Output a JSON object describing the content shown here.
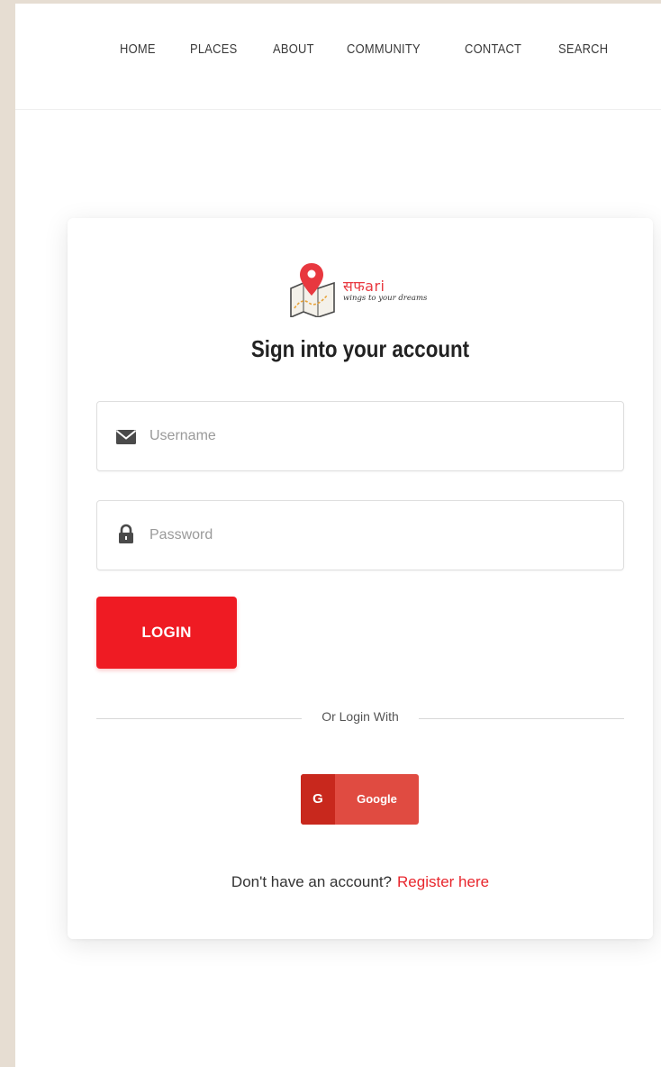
{
  "nav": {
    "items": [
      {
        "label": "HOME"
      },
      {
        "label": "PLACES"
      },
      {
        "label": "ABOUT"
      },
      {
        "label": "COMMUNITY"
      },
      {
        "label": "CONTACT"
      },
      {
        "label": "SEARCH"
      }
    ]
  },
  "logo": {
    "brand": "सफari",
    "tagline": "wings to your dreams",
    "icon": "map-pin-icon"
  },
  "login": {
    "title": "Sign into your account",
    "username": {
      "value": "",
      "placeholder": "Username",
      "icon": "envelope-icon"
    },
    "password": {
      "value": "",
      "placeholder": "Password",
      "icon": "lock-icon"
    },
    "login_label": "LOGIN",
    "divider_text": "Or Login With",
    "google": {
      "letter": "G",
      "label": "Google"
    },
    "register_prompt": "Don't have an account?",
    "register_link": "Register here"
  },
  "colors": {
    "accent": "#ef1b23",
    "google": "#e04b41",
    "google_dark": "#c8281d",
    "link": "#e8262d",
    "background": "#e6ddd2"
  }
}
